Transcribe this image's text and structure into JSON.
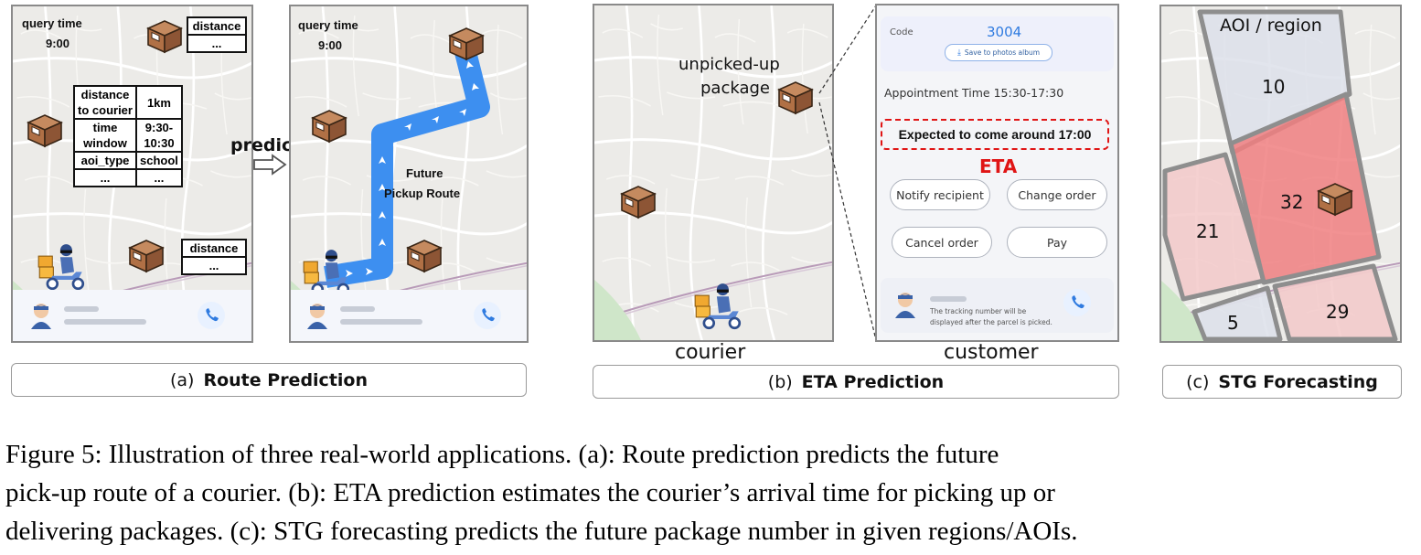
{
  "panel_a": {
    "query_time_label": "query time",
    "query_time_value": "9:00",
    "table_top_label": "distance",
    "table_top_value": "...",
    "attr_table": [
      [
        "distance to courier",
        "1km"
      ],
      [
        "time window",
        "9:30-10:30"
      ],
      [
        "aoi_type",
        "school"
      ],
      [
        "...",
        "..."
      ]
    ],
    "table_bottom_label": "distance",
    "table_bottom_value": "...",
    "predict_label": "predict",
    "future_route_label_1": "Future",
    "future_route_label_2": "Pickup Route",
    "caption_prefix": "(a)",
    "caption_title": "Route Prediction"
  },
  "panel_b": {
    "unpicked_label_1": "unpicked-up",
    "unpicked_label_2": "package",
    "courier_label": "courier",
    "customer_label": "customer",
    "code_label": "Code",
    "code_value": "3004",
    "save_button": "Save to photos album",
    "appointment_text": "Appointment Time 15:30-17:30",
    "expected_text": "Expected to come around 17:00",
    "eta_label": "ETA",
    "buttons": [
      "Notify recipient",
      "Change order",
      "Cancel order",
      "Pay"
    ],
    "tracking_note_1": "The tracking number will be",
    "tracking_note_2": "displayed after the parcel is picked.",
    "caption_prefix": "(b)",
    "caption_title": "ETA Prediction"
  },
  "panel_c": {
    "title": "AOI / region",
    "regions": [
      {
        "label": "10",
        "color": "#dde0ea"
      },
      {
        "label": "21",
        "color": "#f3c9c9"
      },
      {
        "label": "32",
        "color": "#f07f80"
      },
      {
        "label": "5",
        "color": "#dde0ea"
      },
      {
        "label": "29",
        "color": "#f3c9c9"
      }
    ],
    "caption_prefix": "(c)",
    "caption_title": "STG Forecasting"
  },
  "figure_caption": {
    "line1": "Figure 5: Illustration of three real-world applications.  (a): Route prediction predicts the future",
    "line2": "pick-up route of a courier. (b): ETA prediction estimates the courier’s arrival time for picking up or",
    "line3": "delivering packages. (c): STG forecasting predicts the future package number in given regions/AOIs."
  },
  "colors": {
    "route_blue": "#3d8ff0",
    "eta_red": "#e01515",
    "code_blue": "#2f7be0",
    "map_bg": "#ecebe8"
  },
  "icons": [
    "package-box-icon",
    "courier-scooter-icon",
    "avatar-icon",
    "phone-icon",
    "download-icon",
    "hollow-arrow-icon"
  ]
}
